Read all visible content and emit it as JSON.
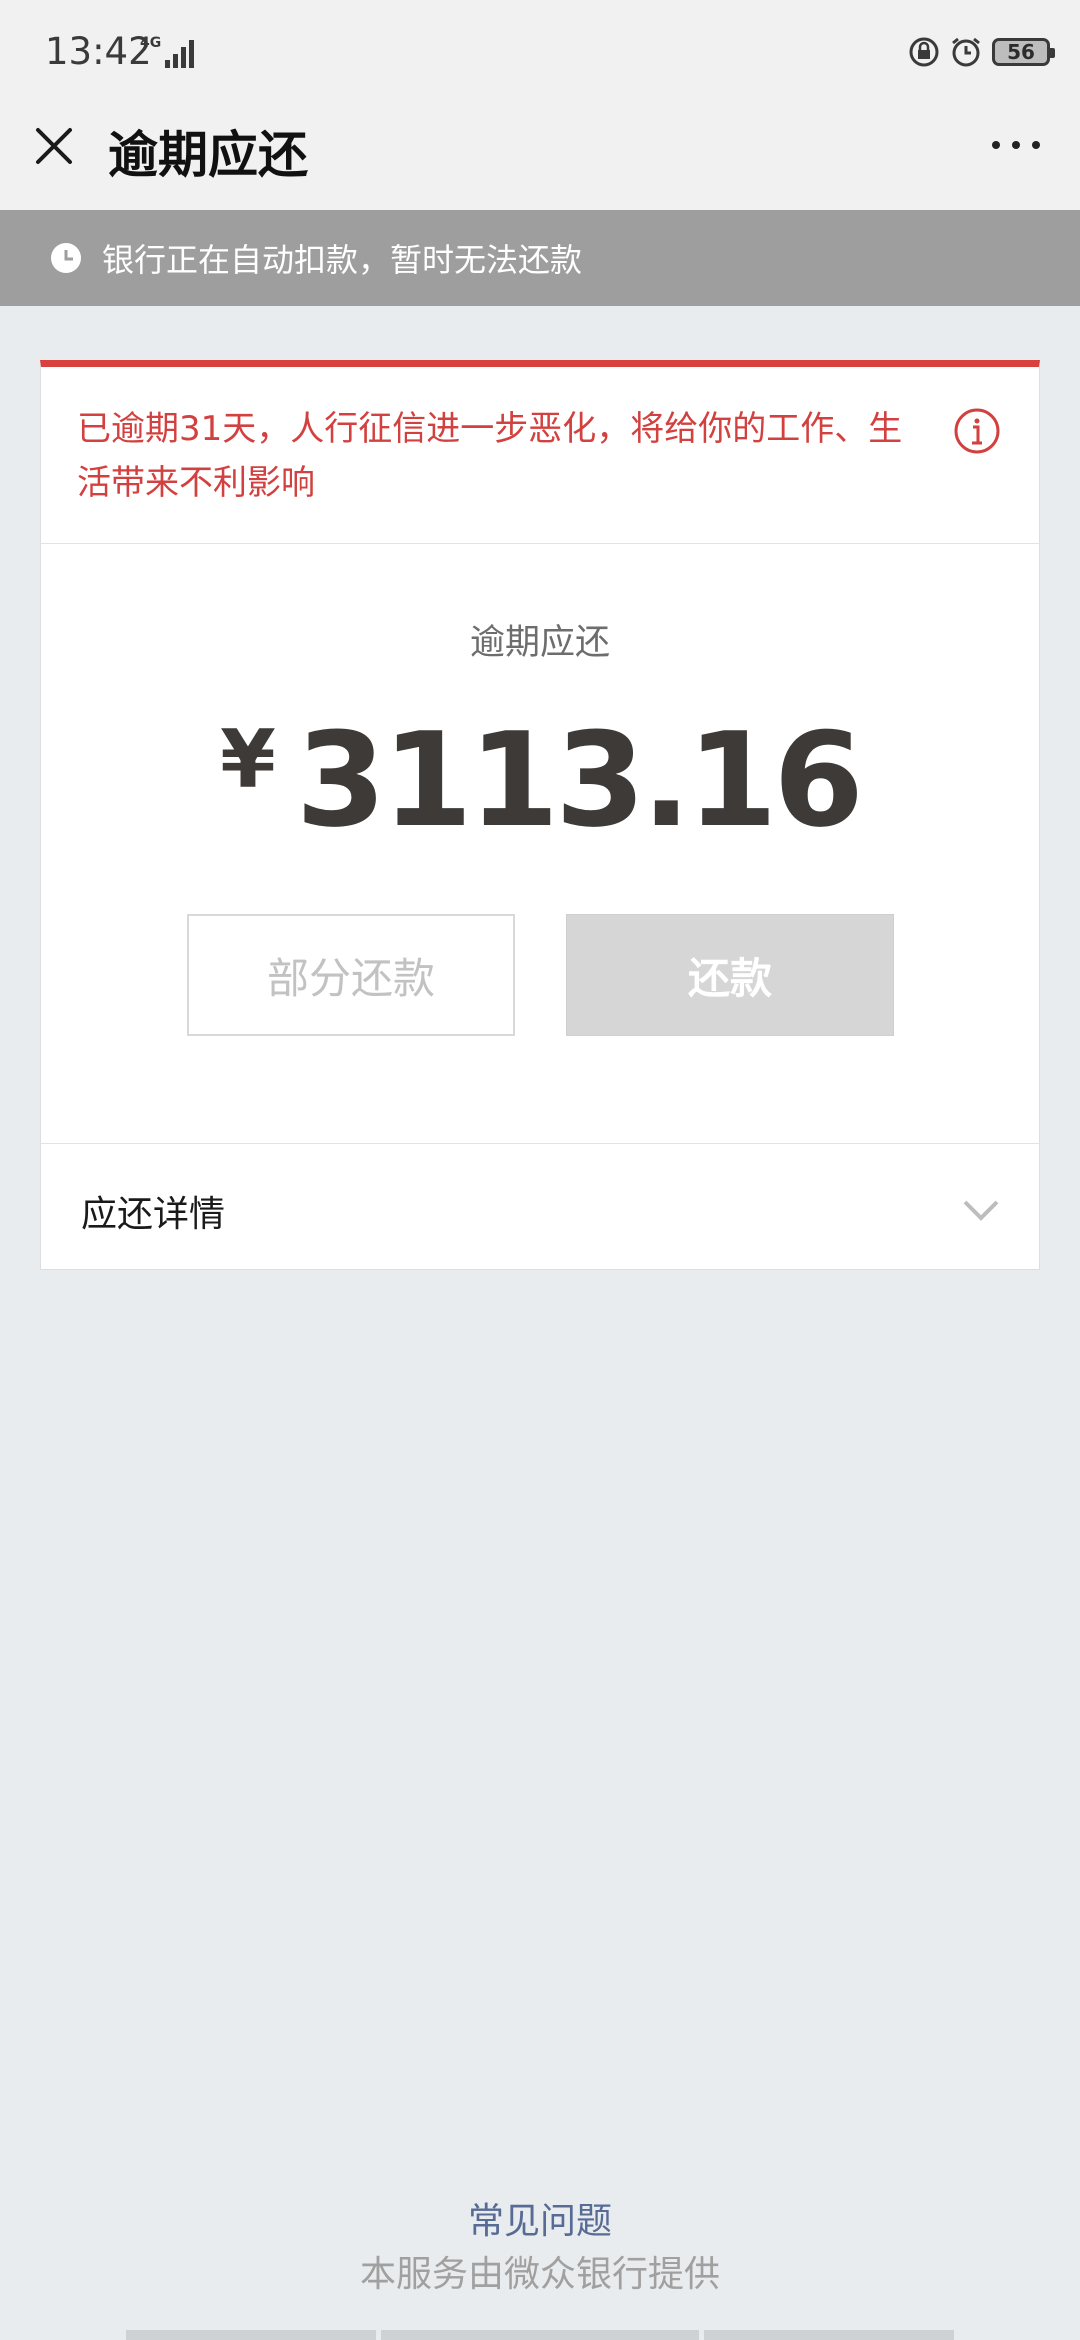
{
  "status_bar": {
    "time": "13:42",
    "network": "4G",
    "battery": "56",
    "icons": [
      "lock-rotation-icon",
      "alarm-icon",
      "battery-icon"
    ]
  },
  "header": {
    "title": "逾期应还",
    "close_icon": "close-icon",
    "more_icon": "more-icon"
  },
  "notice": {
    "text": "银行正在自动扣款，暂时无法还款",
    "icon": "clock-icon"
  },
  "warning": {
    "text": "已逾期31天，人行征信进一步恶化，将给你的工作、生活带来不利影响",
    "icon": "info-icon",
    "color": "#d2413f"
  },
  "amount": {
    "label": "逾期应还",
    "currency": "¥",
    "value": "3113.16"
  },
  "buttons": {
    "partial_label": "部分还款",
    "repay_label": "还款"
  },
  "details": {
    "label": "应还详情",
    "icon": "chevron-down-icon"
  },
  "footer": {
    "faq": "常见问题",
    "provider": "本服务由微众银行提供"
  },
  "colors": {
    "accent_red": "#d9413f",
    "link_blue": "#576b95",
    "notice_bg": "#9e9e9e"
  }
}
